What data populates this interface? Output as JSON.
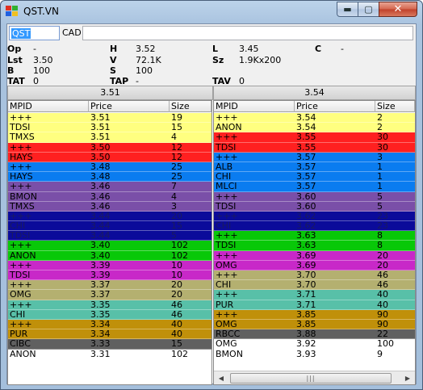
{
  "window": {
    "title": "QST.VN"
  },
  "symbol": {
    "value": "QST",
    "exchange": "CAD"
  },
  "quote": {
    "op_label": "Op",
    "op_value": "-",
    "h_label": "H",
    "h_value": "3.52",
    "l_label": "L",
    "l_value": "3.45",
    "c_label": "C",
    "c_value": "-",
    "lst_label": "Lst",
    "lst_value": "3.50",
    "v_label": "V",
    "v_value": "72.1K",
    "sz_label": "Sz",
    "sz_value": "1.9Kx200",
    "b_label": "B",
    "b_value": "100",
    "s_label": "S",
    "s_value": "100",
    "tat_label": "TAT",
    "tat_value": "0",
    "tap_label": "TAP",
    "tap_value": "-",
    "tav_label": "TAV",
    "tav_value": "0"
  },
  "bid_price": "3.51",
  "ask_price": "3.54",
  "columns": {
    "mpid": "MPID",
    "price": "Price",
    "size": "Size"
  },
  "colors": {
    "yellow": "#ffff80",
    "red": "#ff2020",
    "blue": "#0a7cf0",
    "purple": "#7a4fa8",
    "navy": "#0b0b9a",
    "green": "#08c808",
    "magenta": "#c828c8",
    "khaki": "#b4b070",
    "teal": "#58c0a8",
    "gold": "#c0900a",
    "gray": "#606060",
    "white": "#ffffff"
  },
  "bids": [
    {
      "mpid": "+++",
      "price": "3.51",
      "size": "19",
      "color": "yellow"
    },
    {
      "mpid": "TDSI",
      "price": "3.51",
      "size": "15",
      "color": "yellow"
    },
    {
      "mpid": "TMXS",
      "price": "3.51",
      "size": "4",
      "color": "yellow"
    },
    {
      "mpid": "+++",
      "price": "3.50",
      "size": "12",
      "color": "red"
    },
    {
      "mpid": "HAYS",
      "price": "3.50",
      "size": "12",
      "color": "red"
    },
    {
      "mpid": "+++",
      "price": "3.48",
      "size": "25",
      "color": "blue"
    },
    {
      "mpid": "HAYS",
      "price": "3.48",
      "size": "25",
      "color": "blue"
    },
    {
      "mpid": "+++",
      "price": "3.46",
      "size": "7",
      "color": "purple"
    },
    {
      "mpid": "BMON",
      "price": "3.46",
      "size": "4",
      "color": "purple"
    },
    {
      "mpid": "TMXS",
      "price": "3.46",
      "size": "3",
      "color": "purple"
    },
    {
      "mpid": "+++",
      "price": "3.44",
      "size": "20",
      "color": "navy"
    },
    {
      "mpid": "CHI",
      "price": "3.44",
      "size": "15",
      "color": "navy"
    },
    {
      "mpid": "TDSI",
      "price": "3.44",
      "size": "5",
      "color": "navy"
    },
    {
      "mpid": "+++",
      "price": "3.40",
      "size": "102",
      "color": "green"
    },
    {
      "mpid": "ANON",
      "price": "3.40",
      "size": "102",
      "color": "green"
    },
    {
      "mpid": "+++",
      "price": "3.39",
      "size": "10",
      "color": "magenta"
    },
    {
      "mpid": "TDSI",
      "price": "3.39",
      "size": "10",
      "color": "magenta"
    },
    {
      "mpid": "+++",
      "price": "3.37",
      "size": "20",
      "color": "khaki"
    },
    {
      "mpid": "OMG",
      "price": "3.37",
      "size": "20",
      "color": "khaki"
    },
    {
      "mpid": "+++",
      "price": "3.35",
      "size": "46",
      "color": "teal"
    },
    {
      "mpid": "CHI",
      "price": "3.35",
      "size": "46",
      "color": "teal"
    },
    {
      "mpid": "+++",
      "price": "3.34",
      "size": "40",
      "color": "gold"
    },
    {
      "mpid": "PUR",
      "price": "3.34",
      "size": "40",
      "color": "gold"
    },
    {
      "mpid": "CIBC",
      "price": "3.33",
      "size": "15",
      "color": "gray"
    },
    {
      "mpid": "ANON",
      "price": "3.31",
      "size": "102",
      "color": "white"
    }
  ],
  "asks": [
    {
      "mpid": "+++",
      "price": "3.54",
      "size": "2",
      "color": "yellow"
    },
    {
      "mpid": "ANON",
      "price": "3.54",
      "size": "2",
      "color": "yellow"
    },
    {
      "mpid": "+++",
      "price": "3.55",
      "size": "30",
      "color": "red"
    },
    {
      "mpid": "TDSI",
      "price": "3.55",
      "size": "30",
      "color": "red"
    },
    {
      "mpid": "+++",
      "price": "3.57",
      "size": "3",
      "color": "blue"
    },
    {
      "mpid": "ALB",
      "price": "3.57",
      "size": "1",
      "color": "blue"
    },
    {
      "mpid": "CHI",
      "price": "3.57",
      "size": "1",
      "color": "blue"
    },
    {
      "mpid": "MLCI",
      "price": "3.57",
      "size": "1",
      "color": "blue"
    },
    {
      "mpid": "+++",
      "price": "3.60",
      "size": "5",
      "color": "purple"
    },
    {
      "mpid": "TDSI",
      "price": "3.60",
      "size": "5",
      "color": "purple"
    },
    {
      "mpid": "+++",
      "price": "3.62",
      "size": "23",
      "color": "navy"
    },
    {
      "mpid": "CHI",
      "price": "3.62",
      "size": "23",
      "color": "navy"
    },
    {
      "mpid": "+++",
      "price": "3.63",
      "size": "8",
      "color": "green"
    },
    {
      "mpid": "TDSI",
      "price": "3.63",
      "size": "8",
      "color": "green"
    },
    {
      "mpid": "+++",
      "price": "3.69",
      "size": "20",
      "color": "magenta"
    },
    {
      "mpid": "OMG",
      "price": "3.69",
      "size": "20",
      "color": "magenta"
    },
    {
      "mpid": "+++",
      "price": "3.70",
      "size": "46",
      "color": "khaki"
    },
    {
      "mpid": "CHI",
      "price": "3.70",
      "size": "46",
      "color": "khaki"
    },
    {
      "mpid": "+++",
      "price": "3.71",
      "size": "40",
      "color": "teal"
    },
    {
      "mpid": "PUR",
      "price": "3.71",
      "size": "40",
      "color": "teal"
    },
    {
      "mpid": "+++",
      "price": "3.85",
      "size": "90",
      "color": "gold"
    },
    {
      "mpid": "OMG",
      "price": "3.85",
      "size": "90",
      "color": "gold"
    },
    {
      "mpid": "RBCC",
      "price": "3.88",
      "size": "22",
      "color": "gray"
    },
    {
      "mpid": "OMG",
      "price": "3.92",
      "size": "100",
      "color": "white"
    },
    {
      "mpid": "BMON",
      "price": "3.93",
      "size": "9",
      "color": "white"
    }
  ]
}
